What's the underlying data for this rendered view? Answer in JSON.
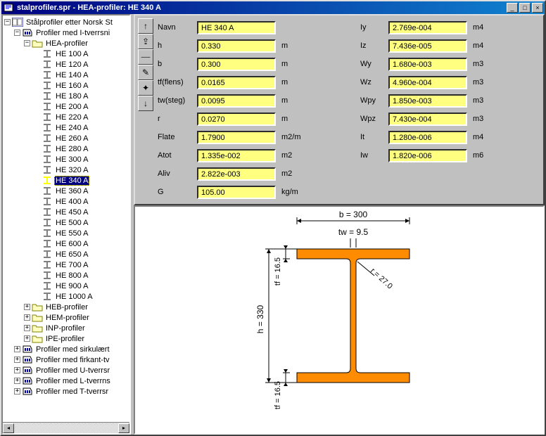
{
  "window": {
    "title": "stalprofiler.spr - HEA-profiler: HE 340 A"
  },
  "tree": {
    "root": "Stålprofiler etter Norsk St",
    "lvl1": "Profiler med I-tverrsni",
    "lvl2": "HEA-profiler",
    "items": [
      "HE 100 A",
      "HE 120 A",
      "HE 140 A",
      "HE 160 A",
      "HE 180 A",
      "HE 200 A",
      "HE 220 A",
      "HE 240 A",
      "HE 260 A",
      "HE 280 A",
      "HE 300 A",
      "HE 320 A",
      "HE 340 A",
      "HE 360 A",
      "HE 400 A",
      "HE 450 A",
      "HE 500 A",
      "HE 550 A",
      "HE 600 A",
      "HE 650 A",
      "HE 700 A",
      "HE 800 A",
      "HE 900 A",
      "HE 1000 A"
    ],
    "selected": "HE 340 A",
    "siblings": [
      "HEB-profiler",
      "HEM-profiler",
      "INP-profiler",
      "IPE-profiler"
    ],
    "other": [
      "Profiler med sirkulært",
      "Profiler med firkant-tv",
      "Profiler med U-tverrsr",
      "Profiler med L-tverrns",
      "Profiler med T-tverrsr"
    ]
  },
  "props": {
    "left": [
      {
        "label": "Navn",
        "value": "HE 340 A",
        "unit": ""
      },
      {
        "label": "h",
        "value": "0.330",
        "unit": "m"
      },
      {
        "label": "b",
        "value": "0.300",
        "unit": "m"
      },
      {
        "label": "tf(flens)",
        "value": "0.0165",
        "unit": "m"
      },
      {
        "label": "tw(steg)",
        "value": "0.0095",
        "unit": "m"
      },
      {
        "label": "r",
        "value": "0.0270",
        "unit": "m"
      },
      {
        "label": "Flate",
        "value": "1.7900",
        "unit": "m2/m"
      },
      {
        "label": "Atot",
        "value": "1.335e-002",
        "unit": "m2"
      },
      {
        "label": "Aliv",
        "value": "2.822e-003",
        "unit": "m2"
      },
      {
        "label": "G",
        "value": "105.00",
        "unit": "kg/m"
      }
    ],
    "right": [
      {
        "label": "Iy",
        "value": "2.769e-004",
        "unit": "m4"
      },
      {
        "label": "Iz",
        "value": "7.436e-005",
        "unit": "m4"
      },
      {
        "label": "Wy",
        "value": "1.680e-003",
        "unit": "m3"
      },
      {
        "label": "Wz",
        "value": "4.960e-004",
        "unit": "m3"
      },
      {
        "label": "Wpy",
        "value": "1.850e-003",
        "unit": "m3"
      },
      {
        "label": "Wpz",
        "value": "7.430e-004",
        "unit": "m3"
      },
      {
        "label": "It",
        "value": "1.280e-006",
        "unit": "m4"
      },
      {
        "label": "Iw",
        "value": "1.820e-006",
        "unit": "m6"
      }
    ]
  },
  "diagram": {
    "b": "b = 300",
    "tw": "tw = 9.5",
    "tf_top": "tf = 16.5",
    "tf_bot": "tf = 16.5",
    "h": "h = 330",
    "r": "r = 27.0"
  },
  "toolbar": {
    "up": "↑",
    "up_plus": "⇧",
    "divider": "──",
    "pencil": "✎",
    "spark": "✦",
    "down": "↓"
  }
}
